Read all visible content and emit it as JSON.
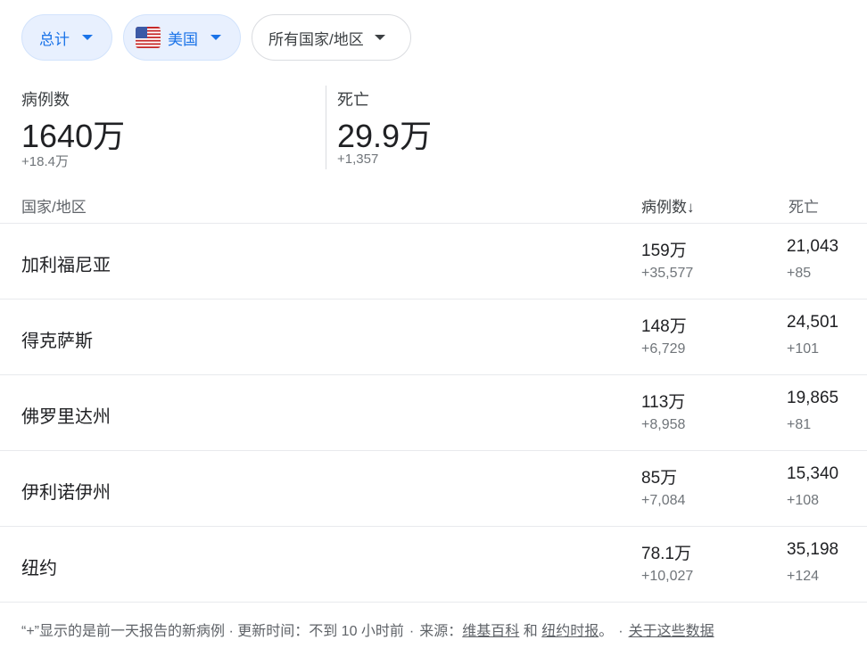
{
  "filters": {
    "total_label": "总计",
    "country_label": "美国",
    "region_label": "所有国家/地区"
  },
  "summary": {
    "cases_label": "病例数",
    "cases_value": "1640万",
    "cases_delta": "+18.4万",
    "deaths_label": "死亡",
    "deaths_value": "29.9万",
    "deaths_delta": "+1,357"
  },
  "table": {
    "col_region": "国家/地区",
    "col_cases": "病例数",
    "col_cases_sort": "↓",
    "col_deaths": "死亡",
    "rows": [
      {
        "name": "加利福尼亚",
        "cases": "159万",
        "cases_delta": "+35,577",
        "deaths": "21,043",
        "deaths_delta": "+85"
      },
      {
        "name": "得克萨斯",
        "cases": "148万",
        "cases_delta": "+6,729",
        "deaths": "24,501",
        "deaths_delta": "+101"
      },
      {
        "name": "佛罗里达州",
        "cases": "113万",
        "cases_delta": "+8,958",
        "deaths": "19,865",
        "deaths_delta": "+81"
      },
      {
        "name": "伊利诺伊州",
        "cases": "85万",
        "cases_delta": "+7,084",
        "deaths": "15,340",
        "deaths_delta": "+108"
      },
      {
        "name": "纽约",
        "cases": "78.1万",
        "cases_delta": "+10,027",
        "deaths": "35,198",
        "deaths_delta": "+124"
      }
    ]
  },
  "footer": {
    "note": "“+”显示的是前一天报告的新病例 · 更新时间：不到 10 小时前",
    "dot1": "·",
    "source_prefix": "来源：",
    "source1": "维基百科",
    "and": "和",
    "source2": "纽约时报",
    "period": "。",
    "dot2": "·",
    "about": "关于这些数据"
  },
  "colors": {
    "accent": "#1a73e8",
    "chip_selected_bg": "#e8f0fe"
  },
  "icons": {
    "dropdown": "caret-down-icon",
    "flag": "us-flag-icon"
  }
}
